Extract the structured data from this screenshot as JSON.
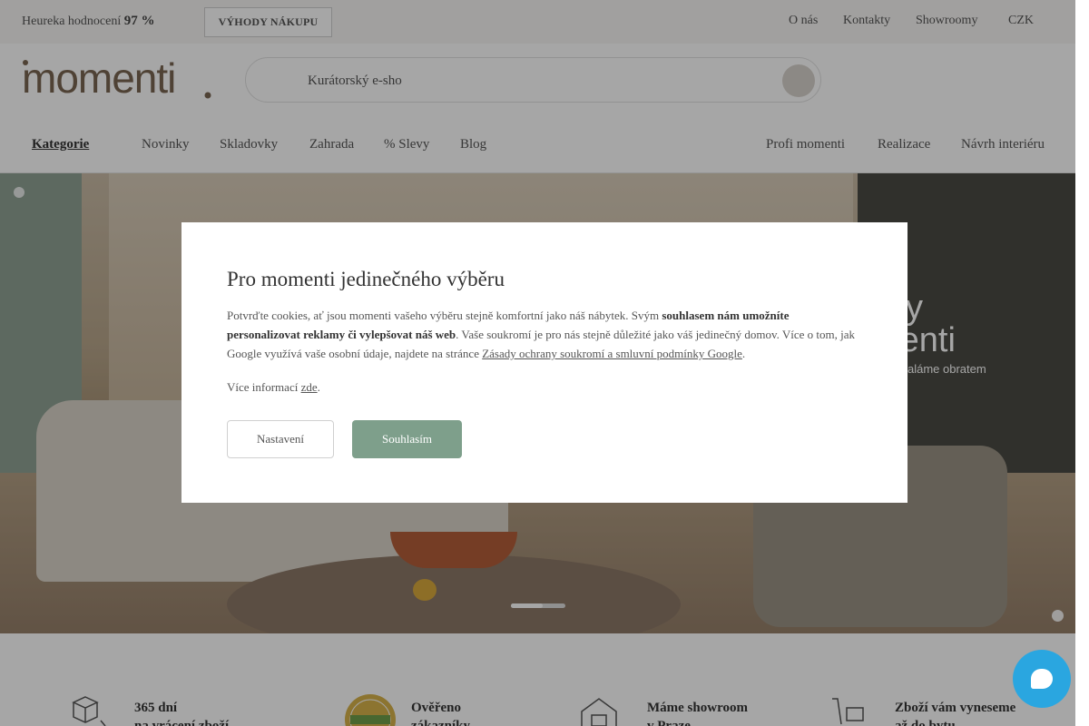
{
  "topbar": {
    "rating_label": "Heureka hodnocení",
    "rating_value": "97 %",
    "benefits_button": "VÝHODY NÁKUPU",
    "links": [
      "O nás",
      "Kontakty",
      "Showroomy"
    ],
    "currency": "CZK"
  },
  "header": {
    "logo_text": "momenti",
    "search_value": "Kurátorský e-sho",
    "nav_category": "Kategorie",
    "nav_left": [
      "Novinky",
      "Skladovky",
      "Zahrada",
      "% Slevy",
      "Blog"
    ],
    "nav_right": [
      "Profi momenti",
      "Realizace",
      "Návrh interiéru"
    ]
  },
  "hero": {
    "brand_partial": "sky\nmenti",
    "tagline_partial": "aláme obratem"
  },
  "benefits": [
    {
      "icon": "box-icon",
      "line1": "365 dní",
      "line2": "na vrácení zboží"
    },
    {
      "icon": "verified-badge-icon",
      "line1": "Ověřeno",
      "line2": "zákazníky"
    },
    {
      "icon": "showroom-house-icon",
      "line1": "Máme showroom",
      "line2": "v Praze"
    },
    {
      "icon": "hand-truck-icon",
      "line1": "Zboží vám vyneseme",
      "line2": "až do bytu"
    }
  ],
  "cookie_modal": {
    "title": "Pro momenti jedinečného výběru",
    "text_intro": "Potvrďte cookies, ať jsou momenti vašeho výběru stejně komfortní jako náš nábytek. Svým ",
    "text_bold": "souhlasem nám umožníte personalizovat reklamy či vylepšovat náš web",
    "text_rest": ". Vaše soukromí je pro nás stejně důležité jako váš jedinečný domov. Více o tom, jak Google využívá vaše osobní údaje, najdete na stránce ",
    "google_link": "Zásady ochrany soukromí a smluvní podmínky Google",
    "text_end": ".",
    "more_label": "Více informací ",
    "more_link": "zde",
    "more_end": ".",
    "settings_button": "Nastavení",
    "accept_button": "Souhlasím"
  },
  "colors": {
    "accent_green": "#7e9f8b",
    "chat_blue": "#2aa6e0",
    "logo_brown": "#7a6652"
  }
}
